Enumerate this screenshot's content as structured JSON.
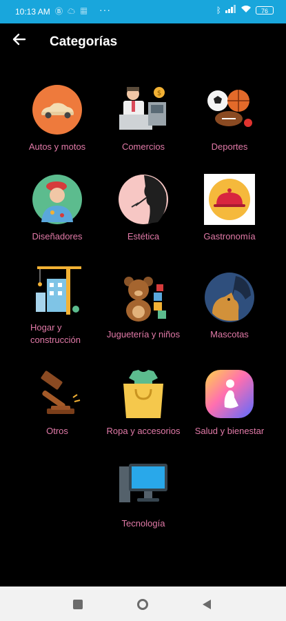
{
  "status": {
    "time": "10:13 AM",
    "battery": "76"
  },
  "header": {
    "title": "Categorías",
    "back_icon": "arrow-left-icon"
  },
  "categories": [
    {
      "label": "Autos y motos",
      "icon": "car-icon"
    },
    {
      "label": "Comercios",
      "icon": "shop-cashier-icon"
    },
    {
      "label": "Deportes",
      "icon": "sports-balls-icon"
    },
    {
      "label": "Diseñadores",
      "icon": "painter-icon"
    },
    {
      "label": "Estética",
      "icon": "beauty-face-icon"
    },
    {
      "label": "Gastronomía",
      "icon": "cloche-icon"
    },
    {
      "label": "Hogar y construcción",
      "icon": "crane-building-icon"
    },
    {
      "label": "Juguetería y niños",
      "icon": "teddy-bear-icon"
    },
    {
      "label": "Mascotas",
      "icon": "pets-icon"
    },
    {
      "label": "Otros",
      "icon": "gavel-icon"
    },
    {
      "label": "Ropa y accesorios",
      "icon": "shopping-bag-icon"
    },
    {
      "label": "Salud y bienestar",
      "icon": "wellness-icon"
    },
    {
      "label": "Tecnología",
      "icon": "computer-icon"
    }
  ]
}
